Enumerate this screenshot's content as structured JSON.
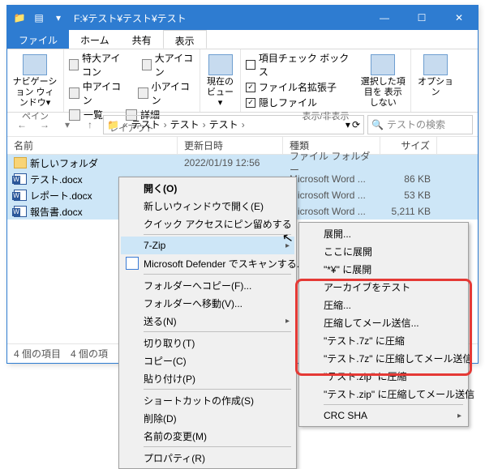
{
  "titlebar": {
    "path": "F:¥テスト¥テスト¥テスト"
  },
  "tabs": {
    "file": "ファイル",
    "home": "ホーム",
    "share": "共有",
    "view": "表示"
  },
  "ribbon": {
    "nav": {
      "btn": "ナビゲーション\nウィンドウ▾",
      "label": "ペイン"
    },
    "layout": {
      "extra_large": "特大アイコン",
      "large": "大アイコン",
      "medium": "中アイコン",
      "small": "小アイコン",
      "list": "一覧",
      "details": "詳細",
      "label": "レイアウト"
    },
    "current": {
      "btn": "現在の\nビュー▾"
    },
    "show": {
      "chk1": "項目チェック ボックス",
      "chk2": "ファイル名拡張子",
      "chk3": "隠しファイル",
      "btn": "選択した項目を\n表示しない",
      "label": "表示/非表示"
    },
    "options": "オプション"
  },
  "breadcrumbs": [
    "テスト",
    "テスト",
    "テスト"
  ],
  "search_placeholder": "テストの検索",
  "columns": {
    "name": "名前",
    "date": "更新日時",
    "type": "種類",
    "size": "サイズ"
  },
  "files": [
    {
      "name": "新しいフォルダ",
      "date": "2022/01/19 12:56",
      "type": "ファイル フォルダー",
      "size": "",
      "icon": "folder"
    },
    {
      "name": "テスト.docx",
      "date": "",
      "type": "Microsoft Word ...",
      "size": "86 KB",
      "icon": "doc"
    },
    {
      "name": "レポート.docx",
      "date": "",
      "type": "Microsoft Word ...",
      "size": "53 KB",
      "icon": "doc"
    },
    {
      "name": "報告書.docx",
      "date": "",
      "type": "Microsoft Word ...",
      "size": "5,211 KB",
      "icon": "doc"
    }
  ],
  "status": {
    "count": "4 個の項目",
    "sel": "4 個の項"
  },
  "ctx1": [
    {
      "t": "開く(O)",
      "b": true
    },
    {
      "t": "新しいウィンドウで開く(E)"
    },
    {
      "t": "クイック アクセスにピン留めする"
    },
    {
      "sep": true
    },
    {
      "t": "7-Zip",
      "arr": true,
      "hi": true
    },
    {
      "t": "Microsoft Defender でスキャンする...",
      "ico": "shield"
    },
    {
      "sep": true
    },
    {
      "t": "フォルダーへコピー(F)..."
    },
    {
      "t": "フォルダーへ移動(V)..."
    },
    {
      "t": "送る(N)",
      "arr": true
    },
    {
      "sep": true
    },
    {
      "t": "切り取り(T)"
    },
    {
      "t": "コピー(C)"
    },
    {
      "t": "貼り付け(P)"
    },
    {
      "sep": true
    },
    {
      "t": "ショートカットの作成(S)"
    },
    {
      "t": "削除(D)"
    },
    {
      "t": "名前の変更(M)"
    },
    {
      "sep": true
    },
    {
      "t": "プロパティ(R)"
    }
  ],
  "ctx2": [
    {
      "t": "展開..."
    },
    {
      "t": "ここに展開"
    },
    {
      "t": "\"*¥\" に展開"
    },
    {
      "t": "アーカイブをテスト"
    },
    {
      "t": "圧縮..."
    },
    {
      "t": "圧縮してメール送信..."
    },
    {
      "t": "\"テスト.7z\" に圧縮"
    },
    {
      "t": "\"テスト.7z\" に圧縮してメール送信"
    },
    {
      "t": "\"テスト.zip\" に圧縮"
    },
    {
      "t": "\"テスト.zip\" に圧縮してメール送信"
    },
    {
      "sep": true
    },
    {
      "t": "CRC SHA",
      "arr": true
    }
  ]
}
